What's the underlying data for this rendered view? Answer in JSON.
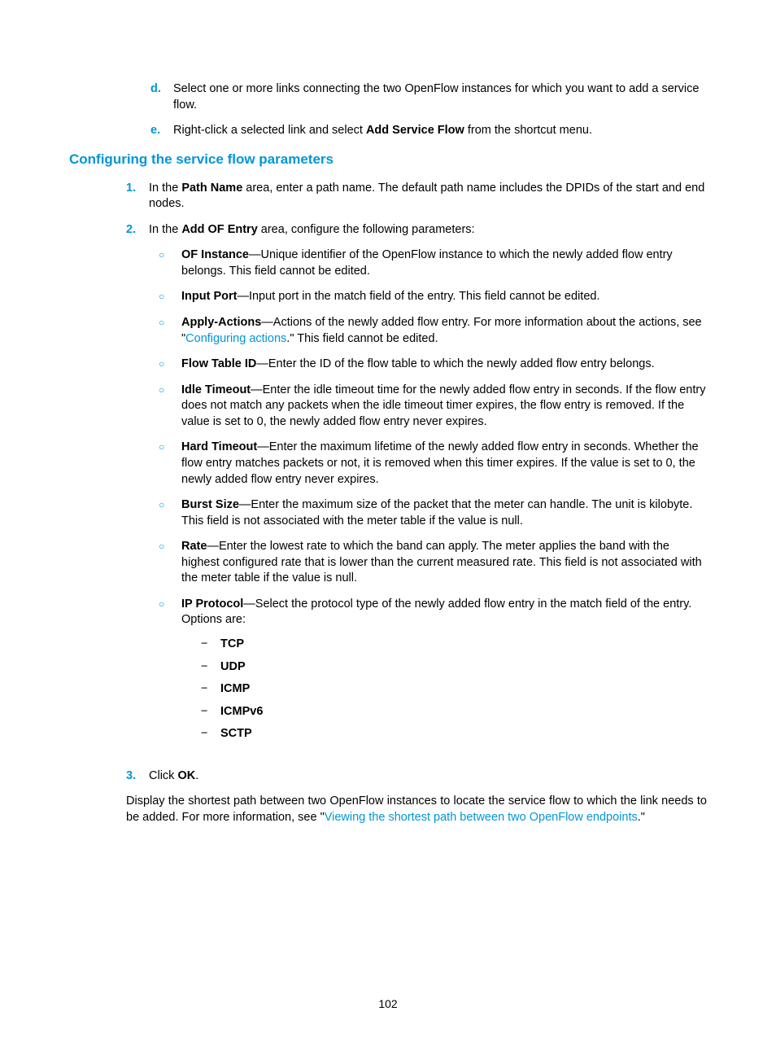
{
  "items_d": {
    "marker": "d.",
    "text": "Select one or more links connecting the two OpenFlow instances for which you want to add a service flow."
  },
  "items_e": {
    "marker": "e.",
    "text_pre": "Right-click a selected link and select ",
    "bold": "Add Service Flow",
    "text_post": " from the shortcut menu."
  },
  "heading": "Configuring the service flow parameters",
  "step1": {
    "marker": "1.",
    "pre": "In the ",
    "bold": "Path Name",
    "post": " area, enter a path name. The default path name includes the DPIDs of the start and end nodes."
  },
  "step2": {
    "marker": "2.",
    "pre": "In the ",
    "bold": "Add OF Entry",
    "post": " area, configure the following parameters:"
  },
  "bullets": {
    "of_instance": {
      "bold": "OF Instance",
      "text": "—Unique identifier of the OpenFlow instance to which the newly added flow entry belongs. This field cannot be edited."
    },
    "input_port": {
      "bold": "Input Port",
      "text": "—Input port in the match field of the entry. This field cannot be edited."
    },
    "apply_actions": {
      "bold": "Apply-Actions",
      "text_pre": "—Actions of the newly added flow entry. For more information about the actions, see \"",
      "link": "Configuring actions",
      "text_post": ".\" This field cannot be edited."
    },
    "flow_table_id": {
      "bold": "Flow Table ID",
      "text": "—Enter the ID of the flow table to which the newly added flow entry belongs."
    },
    "idle_timeout": {
      "bold": "Idle Timeout",
      "text": "—Enter the idle timeout time for the newly added flow entry in seconds. If the flow entry does not match any packets when the idle timeout timer expires, the flow entry is removed. If the value is set to 0, the newly added flow entry never expires."
    },
    "hard_timeout": {
      "bold": "Hard Timeout",
      "text": "—Enter the maximum lifetime of the newly added flow entry in seconds. Whether the flow entry matches packets or not, it is removed when this timer expires. If the value is set to 0, the newly added flow entry never expires."
    },
    "burst_size": {
      "bold": "Burst Size",
      "text": "—Enter the maximum size of the packet that the meter can handle. The unit is kilobyte. This field is not associated with the meter table if the value is null."
    },
    "rate": {
      "bold": "Rate",
      "text": "—Enter the lowest rate to which the band can apply. The meter applies the band with the highest configured rate that is lower than the current measured rate. This field is not associated with the meter table if the value is null."
    },
    "ip_protocol": {
      "bold": "IP Protocol",
      "text": "—Select the protocol type of the newly added flow entry in the match field of the entry. Options are:"
    }
  },
  "protocols": {
    "tcp": "TCP",
    "udp": "UDP",
    "icmp": "ICMP",
    "icmpv6": "ICMPv6",
    "sctp": "SCTP"
  },
  "dash": "−",
  "step3": {
    "marker": "3.",
    "pre": "Click ",
    "bold": "OK",
    "post": "."
  },
  "closing": {
    "pre": "Display the shortest path between two OpenFlow instances to locate the service flow to which the link needs to be added. For more information, see \"",
    "link": "Viewing the shortest path between two OpenFlow endpoints",
    "post": ".\""
  },
  "circle": "○",
  "page_number": "102"
}
